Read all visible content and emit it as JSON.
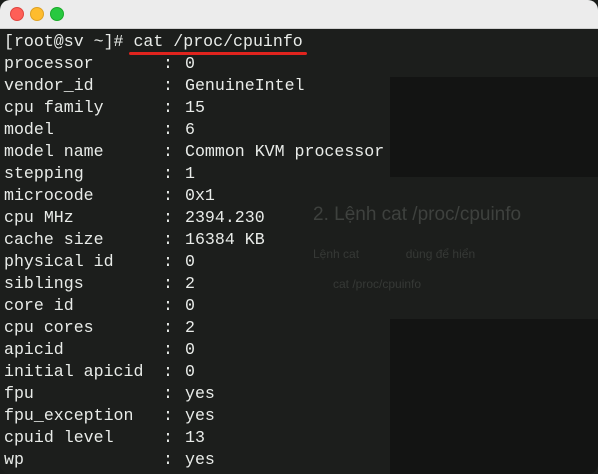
{
  "window": {
    "traffic_lights": [
      "close",
      "minimize",
      "maximize"
    ],
    "colors": {
      "close": "#fe5f57",
      "minimize": "#febc2e",
      "maximize": "#28c840",
      "underline": "#e0241e"
    }
  },
  "terminal": {
    "prompt": "[root@sv ~]# ",
    "command": "cat /proc/cpuinfo",
    "rows": [
      {
        "key": "processor",
        "value": "0"
      },
      {
        "key": "vendor_id",
        "value": "GenuineIntel"
      },
      {
        "key": "cpu family",
        "value": "15"
      },
      {
        "key": "model",
        "value": "6"
      },
      {
        "key": "model name",
        "value": "Common KVM processor"
      },
      {
        "key": "stepping",
        "value": "1"
      },
      {
        "key": "microcode",
        "value": "0x1"
      },
      {
        "key": "cpu MHz",
        "value": "2394.230"
      },
      {
        "key": "cache size",
        "value": "16384 KB"
      },
      {
        "key": "physical id",
        "value": "0"
      },
      {
        "key": "siblings",
        "value": "2"
      },
      {
        "key": "core id",
        "value": "0"
      },
      {
        "key": "cpu cores",
        "value": "2"
      },
      {
        "key": "apicid",
        "value": "0"
      },
      {
        "key": "initial apicid",
        "value": "0"
      },
      {
        "key": "fpu",
        "value": "yes"
      },
      {
        "key": "fpu_exception",
        "value": "yes"
      },
      {
        "key": "cpuid level",
        "value": "13"
      },
      {
        "key": "wp",
        "value": "yes"
      }
    ]
  }
}
